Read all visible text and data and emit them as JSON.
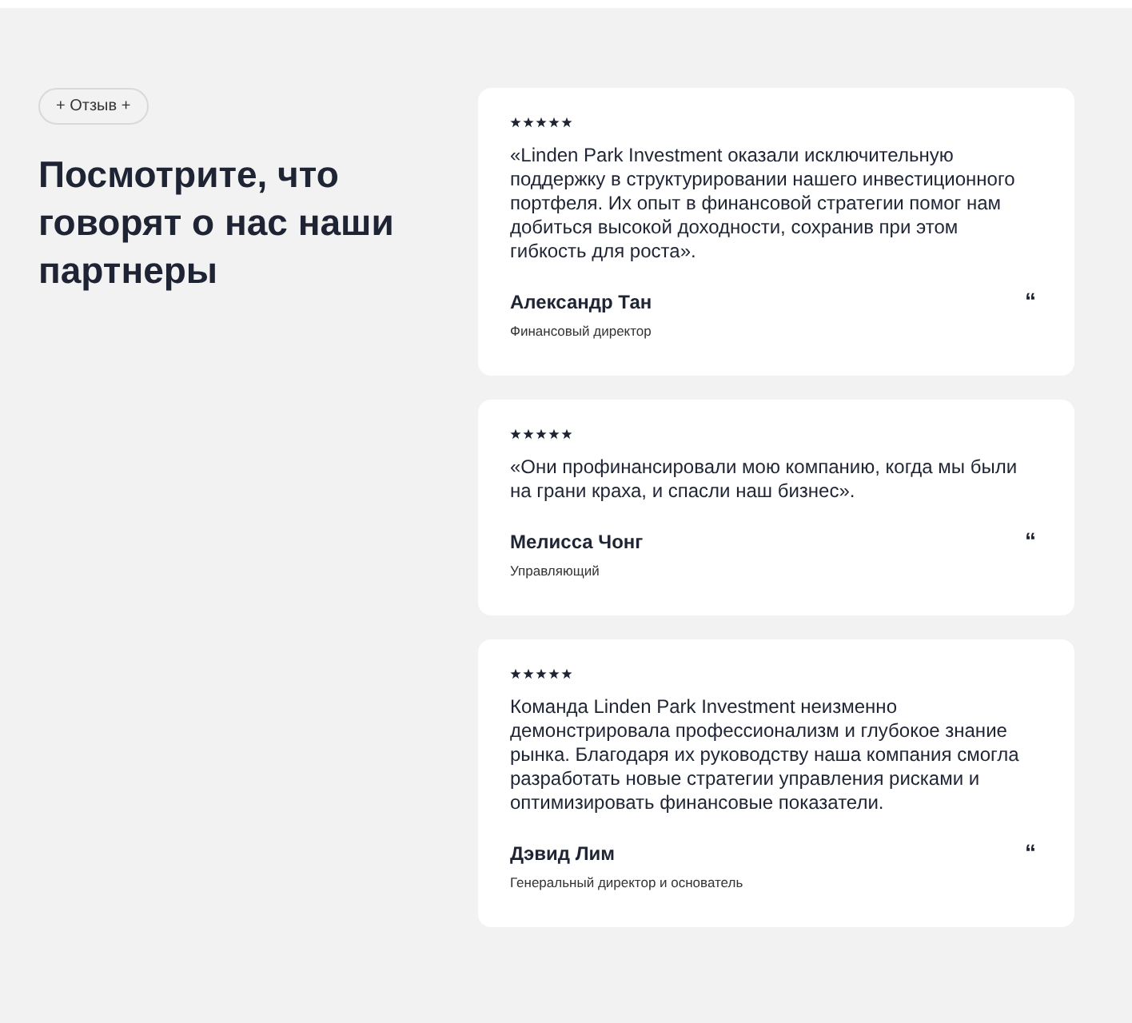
{
  "badge": "+ Отзыв +",
  "heading": "Посмотрите, что говорят о нас наши партнеры",
  "testimonials": [
    {
      "stars": 5,
      "quote": "«Linden Park Investment оказали исключительную поддержку в структурировании нашего инвестиционного портфеля. Их опыт в финансовой стратегии помог нам добиться высокой доходности, сохранив при этом гибкость для роста».",
      "name": "Александр Тан",
      "role": "Финансовый директор",
      "mark": "“"
    },
    {
      "stars": 5,
      "quote": "«Они профинансировали мою компанию, когда мы были на грани краха, и спасли наш бизнес».",
      "name": "Мелисса Чонг",
      "role": "Управляющий",
      "mark": "“"
    },
    {
      "stars": 5,
      "quote": "Команда Linden Park Investment неизменно демонстрировала профессионализм и глубокое знание рынка. Благодаря их руководству наша компания смогла разработать новые стратегии управления рисками и оптимизировать финансовые показатели.",
      "name": "Дэвид Лим",
      "role": "Генеральный директор и основатель",
      "mark": "“"
    }
  ]
}
